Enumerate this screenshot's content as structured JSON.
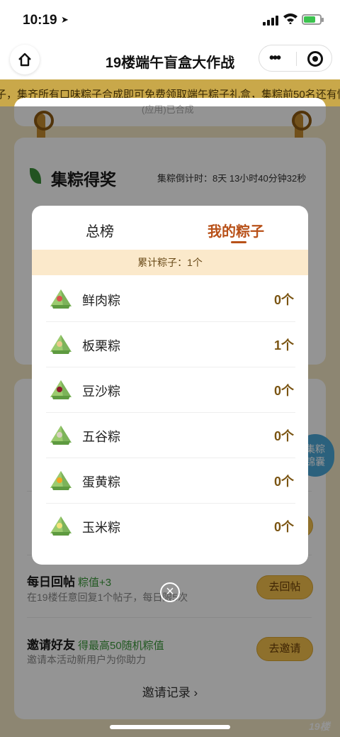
{
  "status": {
    "time": "10:19",
    "location_icon": "location-arrow-icon",
    "battery": "charging"
  },
  "nav": {
    "title": "19楼端午盲盒大作战"
  },
  "marquee": {
    "text": "子，集齐所有口味粽子合成即可免费领取端午粽子礼盒，集粽前50名还有惊"
  },
  "background": {
    "section_title": "集粽得奖",
    "countdown": "集粽倒计时：8天 13小时40分钟32秒",
    "top_card_text": "(应用)已合成",
    "tasks": [
      {
        "title": "每日回帖",
        "bonus": "粽值+3",
        "desc": "在19楼任意回复1个帖子，每日限5次",
        "button": "去回帖"
      },
      {
        "title": "邀请好友",
        "bonus": "得最高50随机粽值",
        "desc": "邀请本活动新用户为你助力",
        "button": "去邀请"
      }
    ],
    "invite_record": "邀请记录 ›",
    "float_button": "集粽\n锦囊",
    "watermark": "19楼"
  },
  "modal": {
    "tabs": [
      {
        "label": "总榜",
        "active": false
      },
      {
        "label": "我的粽子",
        "active": true
      }
    ],
    "summary": "累计粽子：1个",
    "items": [
      {
        "name": "鲜肉粽",
        "count": "0个",
        "filling_color": "#d9534f"
      },
      {
        "name": "板栗粽",
        "count": "1个",
        "filling_color": "#e8c98a"
      },
      {
        "name": "豆沙粽",
        "count": "0个",
        "filling_color": "#8b1a2b"
      },
      {
        "name": "五谷粽",
        "count": "0个",
        "filling_color": "#d8d1c0"
      },
      {
        "name": "蛋黄粽",
        "count": "0个",
        "filling_color": "#f3a425"
      },
      {
        "name": "玉米粽",
        "count": "0个",
        "filling_color": "#f4e27a"
      }
    ]
  },
  "colors": {
    "accent": "#b85119",
    "count": "#7a5412",
    "summary_bg": "#fbe9cb"
  }
}
